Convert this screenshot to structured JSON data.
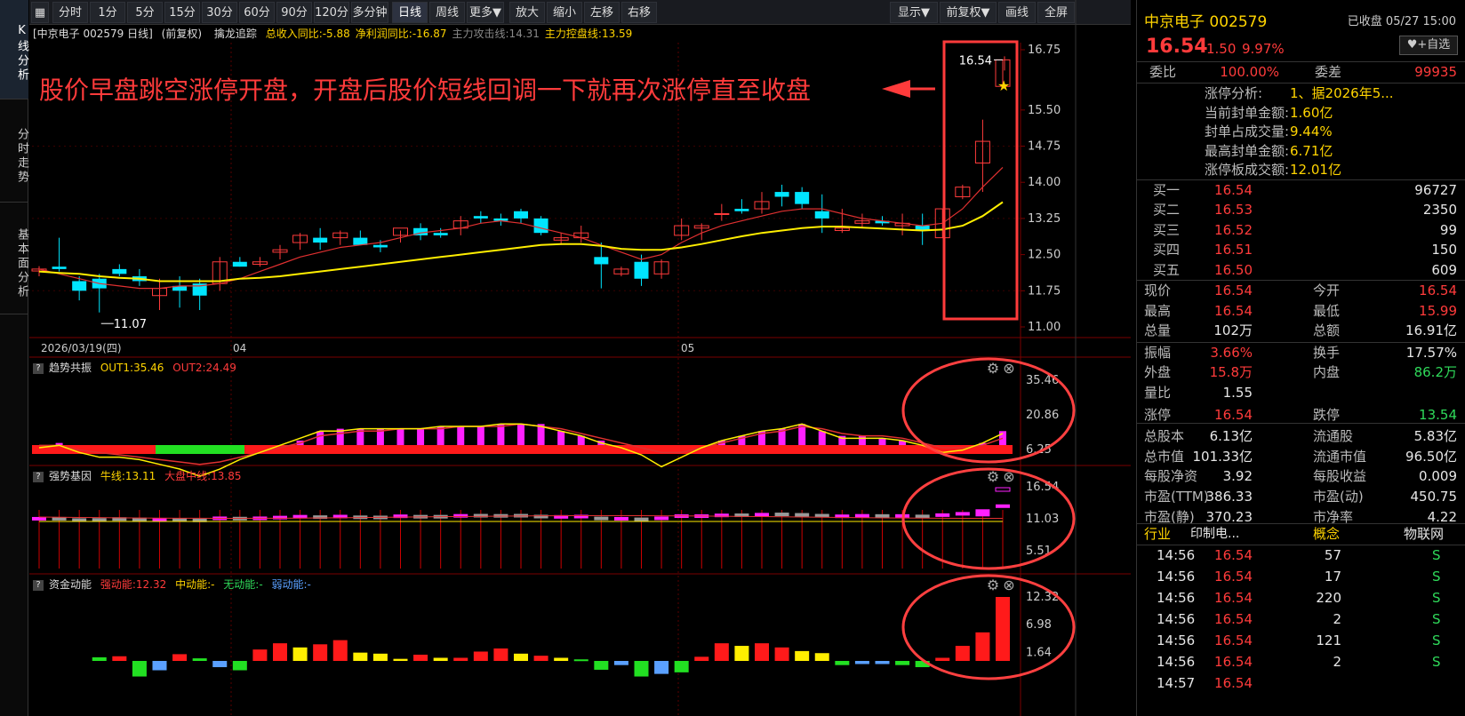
{
  "left_tabs": [
    "K线分析",
    "分时走势",
    "基本面分析"
  ],
  "toolbar": {
    "buttons": [
      "分时",
      "1分",
      "5分",
      "15分",
      "30分",
      "60分",
      "90分",
      "120分",
      "多分钟",
      "日线",
      "周线",
      "更多▼",
      "放大",
      "缩小",
      "左移",
      "右移"
    ],
    "right_buttons": [
      "显示▼",
      "前复权▼",
      "画线",
      "全屏"
    ],
    "active": "日线"
  },
  "info": {
    "stock": "[中京电子 002579 日线]",
    "adj": "(前复权)",
    "indicator": "擒龙追踪",
    "items": [
      {
        "text": "总收入同比:-5.88",
        "color": "#ffd400"
      },
      {
        "text": "净利润同比:-16.87",
        "color": "#ffd400"
      },
      {
        "text": "主力攻击线:14.31",
        "color": "#888888"
      },
      {
        "text": "主力控盘线:13.59",
        "color": "#ffd400"
      }
    ]
  },
  "annotation": {
    "text": "股价早盘跳空涨停开盘，开盘后股价短线回调一下就再次涨停直至收盘",
    "color": "#ff3b3b"
  },
  "price_axis": [
    "16.75",
    "15.50",
    "14.75",
    "14.00",
    "13.25",
    "12.50",
    "11.75",
    "11.00"
  ],
  "date_axis": {
    "start": "2026/03/19(四)",
    "m1": "04",
    "m2": "05"
  },
  "markers": {
    "low": "11.07",
    "high": "16.54"
  },
  "panel1": {
    "name": "趋势共振",
    "out1": "OUT1:35.46",
    "out2": "OUT2:24.49",
    "axis": [
      "35.46",
      "20.86",
      "6.25"
    ]
  },
  "panel2": {
    "name": "强势基因",
    "l1": "牛线:13.11",
    "l2": "大盘中线:13.85",
    "axis": [
      "16.54",
      "11.03",
      "5.51"
    ]
  },
  "panel3": {
    "name": "资金动能",
    "l1": "强动能:12.32",
    "l2": "中动能:-",
    "l3": "无动能:-",
    "l4": "弱动能:-",
    "axis": [
      "12.32",
      "6.98",
      "1.64"
    ]
  },
  "chart_data": {
    "type": "candlestick",
    "x_range": [
      "2026/03/19",
      "2026/05/27"
    ],
    "y_range": [
      11.0,
      16.75
    ],
    "candles_ohlc": [
      [
        12.16,
        12.26,
        12.05,
        12.2
      ],
      [
        12.25,
        12.85,
        12.15,
        12.2
      ],
      [
        11.95,
        12.05,
        11.55,
        11.75
      ],
      [
        12.0,
        12.1,
        11.3,
        11.8
      ],
      [
        12.2,
        12.3,
        12.05,
        12.1
      ],
      [
        12.05,
        12.2,
        11.85,
        11.95
      ],
      [
        11.65,
        12.0,
        11.35,
        11.8
      ],
      [
        11.85,
        12.05,
        11.4,
        11.75
      ],
      [
        11.9,
        12.0,
        11.35,
        11.65
      ],
      [
        11.9,
        12.45,
        11.75,
        12.35
      ],
      [
        12.35,
        12.45,
        12.25,
        12.25
      ],
      [
        12.3,
        12.45,
        12.25,
        12.35
      ],
      [
        12.55,
        12.7,
        12.4,
        12.6
      ],
      [
        12.75,
        12.95,
        12.6,
        12.9
      ],
      [
        12.85,
        13.05,
        12.6,
        12.75
      ],
      [
        12.85,
        13.0,
        12.7,
        12.95
      ],
      [
        12.85,
        13.0,
        12.7,
        12.7
      ],
      [
        12.7,
        12.8,
        12.55,
        12.65
      ],
      [
        12.9,
        13.0,
        12.75,
        13.05
      ],
      [
        13.05,
        13.15,
        12.8,
        12.9
      ],
      [
        12.95,
        13.05,
        12.85,
        12.9
      ],
      [
        13.05,
        13.3,
        12.9,
        13.2
      ],
      [
        13.3,
        13.4,
        13.15,
        13.25
      ],
      [
        13.25,
        13.35,
        13.1,
        13.2
      ],
      [
        13.4,
        13.45,
        13.15,
        13.25
      ],
      [
        13.25,
        13.3,
        12.9,
        12.95
      ],
      [
        12.8,
        12.95,
        12.7,
        12.85
      ],
      [
        12.85,
        13.1,
        12.75,
        12.95
      ],
      [
        12.45,
        12.75,
        11.8,
        12.3
      ],
      [
        12.1,
        12.25,
        12.05,
        12.2
      ],
      [
        12.35,
        12.5,
        11.85,
        12.0
      ],
      [
        12.1,
        12.4,
        12.0,
        12.35
      ],
      [
        12.9,
        13.25,
        12.8,
        13.1
      ],
      [
        13.05,
        13.15,
        12.8,
        13.1
      ],
      [
        13.35,
        13.55,
        13.2,
        13.35
      ],
      [
        13.45,
        13.65,
        13.35,
        13.4
      ],
      [
        13.45,
        13.8,
        13.35,
        13.6
      ],
      [
        13.8,
        13.95,
        13.5,
        13.7
      ],
      [
        13.8,
        13.9,
        13.45,
        13.55
      ],
      [
        13.4,
        13.75,
        12.95,
        13.25
      ],
      [
        13.0,
        13.45,
        12.95,
        13.05
      ],
      [
        13.15,
        13.35,
        13.05,
        13.2
      ],
      [
        13.2,
        13.3,
        13.1,
        13.15
      ],
      [
        13.1,
        13.35,
        12.9,
        13.15
      ],
      [
        13.1,
        13.35,
        12.7,
        13.0
      ],
      [
        12.85,
        13.45,
        12.85,
        13.45
      ],
      [
        13.7,
        13.95,
        13.65,
        13.9
      ],
      [
        14.4,
        15.3,
        13.8,
        14.85
      ],
      [
        15.99,
        16.54,
        15.99,
        16.54
      ]
    ],
    "ma_short_path_note": "主力攻击线",
    "series": [
      {
        "name": "主力攻击线",
        "values": [
          12.2,
          12.1,
          12.0,
          11.9,
          11.85,
          11.8,
          11.8,
          11.85,
          11.85,
          11.9,
          12.0,
          12.15,
          12.3,
          12.45,
          12.55,
          12.65,
          12.7,
          12.75,
          12.85,
          12.95,
          13.0,
          13.05,
          13.15,
          13.2,
          13.15,
          13.05,
          12.95,
          12.85,
          12.7,
          12.55,
          12.4,
          12.5,
          12.75,
          12.95,
          13.1,
          13.2,
          13.3,
          13.4,
          13.45,
          13.45,
          13.35,
          13.25,
          13.2,
          13.15,
          13.1,
          13.15,
          13.45,
          13.9,
          14.31
        ]
      },
      {
        "name": "主力控盘线",
        "values": [
          12.15,
          12.12,
          12.1,
          12.05,
          12.02,
          12.0,
          11.95,
          11.95,
          11.95,
          11.95,
          12.0,
          12.02,
          12.05,
          12.1,
          12.15,
          12.2,
          12.25,
          12.3,
          12.35,
          12.4,
          12.45,
          12.5,
          12.55,
          12.6,
          12.65,
          12.7,
          12.72,
          12.72,
          12.68,
          12.62,
          12.6,
          12.6,
          12.65,
          12.72,
          12.8,
          12.88,
          12.95,
          13.0,
          13.05,
          13.08,
          13.08,
          13.06,
          13.04,
          13.02,
          13.0,
          13.02,
          13.1,
          13.3,
          13.59
        ]
      }
    ]
  },
  "right": {
    "title": "中京电子 002579",
    "status": "已收盘 05/27 15:00",
    "price": "16.54",
    "change": "1.50",
    "pct": "9.97%",
    "add_btn": "+自选",
    "weibi_lbl": "委比",
    "weibi": "100.00%",
    "weicha_lbl": "委差",
    "weicha": "99935",
    "limit_rows": [
      {
        "k": "涨停分析:",
        "v": "1、据2026年5..."
      },
      {
        "k": "当前封单金额:",
        "v": "1.60亿"
      },
      {
        "k": "封单占成交量:",
        "v": "9.44%"
      },
      {
        "k": "最高封单金额:",
        "v": "6.71亿"
      },
      {
        "k": "涨停板成交额:",
        "v": "12.01亿"
      }
    ],
    "bids": [
      {
        "k": "买一",
        "p": "16.54",
        "v": "96727"
      },
      {
        "k": "买二",
        "p": "16.53",
        "v": "2350"
      },
      {
        "k": "买三",
        "p": "16.52",
        "v": "99"
      },
      {
        "k": "买四",
        "p": "16.51",
        "v": "150"
      },
      {
        "k": "买五",
        "p": "16.50",
        "v": "609"
      }
    ],
    "stats": [
      {
        "k1": "现价",
        "v1": "16.54",
        "c1": "red",
        "k2": "今开",
        "v2": "16.54",
        "c2": "red"
      },
      {
        "k1": "最高",
        "v1": "16.54",
        "c1": "red",
        "k2": "最低",
        "v2": "15.99",
        "c2": "red"
      },
      {
        "k1": "总量",
        "v1": "102万",
        "c1": "white",
        "k2": "总额",
        "v2": "16.91亿",
        "c2": "white"
      },
      {
        "k1": "振幅",
        "v1": "3.66%",
        "c1": "red",
        "k2": "换手",
        "v2": "17.57%",
        "c2": "white"
      },
      {
        "k1": "外盘",
        "v1": "15.8万",
        "c1": "red",
        "k2": "内盘",
        "v2": "86.2万",
        "c2": "green"
      },
      {
        "k1": "量比",
        "v1": "1.55",
        "c1": "white",
        "k2": "",
        "v2": "",
        "c2": "white"
      },
      {
        "k1": "涨停",
        "v1": "16.54",
        "c1": "red",
        "k2": "跌停",
        "v2": "13.54",
        "c2": "green"
      },
      {
        "k1": "总股本",
        "v1": "6.13亿",
        "c1": "white",
        "k2": "流通股",
        "v2": "5.83亿",
        "c2": "white"
      },
      {
        "k1": "总市值",
        "v1": "101.33亿",
        "c1": "white",
        "k2": "流通市值",
        "v2": "96.50亿",
        "c2": "white"
      },
      {
        "k1": "每股净资",
        "v1": "3.92",
        "c1": "white",
        "k2": "每股收益",
        "v2": "0.009",
        "c2": "white"
      },
      {
        "k1": "市盈(TTM)",
        "v1": "386.33",
        "c1": "white",
        "k2": "市盈(动)",
        "v2": "450.75",
        "c2": "white"
      },
      {
        "k1": "市盈(静)",
        "v1": "370.23",
        "c1": "white",
        "k2": "市净率",
        "v2": "4.22",
        "c2": "white"
      }
    ],
    "industry": {
      "k1": "行业",
      "v1": "印制电...",
      "k2": "概念",
      "v2": "物联网"
    },
    "ticks": [
      {
        "t": "14:56",
        "p": "16.54",
        "v": "57",
        "s": "S"
      },
      {
        "t": "14:56",
        "p": "16.54",
        "v": "17",
        "s": "S"
      },
      {
        "t": "14:56",
        "p": "16.54",
        "v": "220",
        "s": "S"
      },
      {
        "t": "14:56",
        "p": "16.54",
        "v": "2",
        "s": "S"
      },
      {
        "t": "14:56",
        "p": "16.54",
        "v": "121",
        "s": "S"
      },
      {
        "t": "14:56",
        "p": "16.54",
        "v": "2",
        "s": "S"
      },
      {
        "t": "14:57",
        "p": "16.54",
        "v": "",
        "s": ""
      }
    ]
  }
}
